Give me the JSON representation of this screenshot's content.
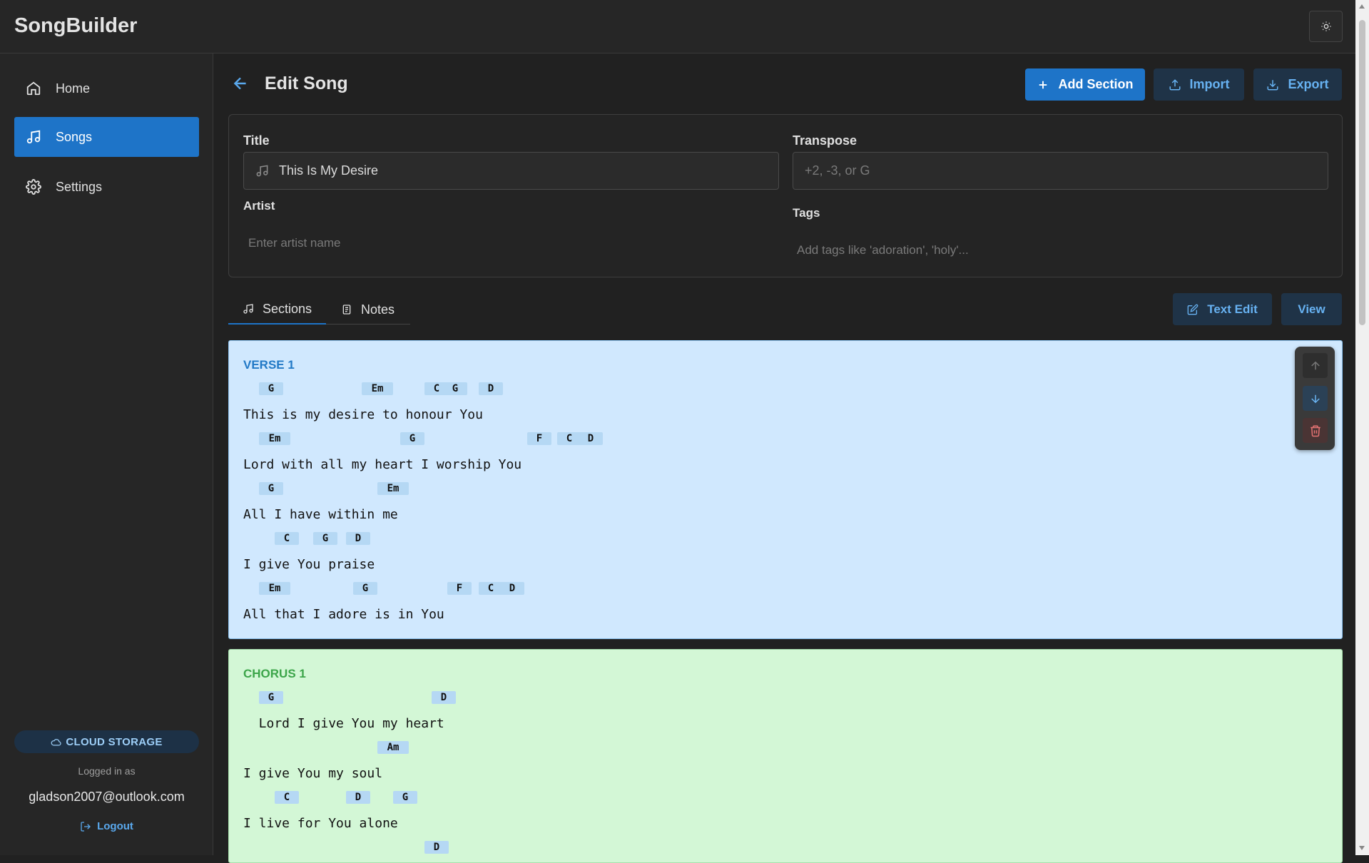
{
  "app": {
    "title": "SongBuilder",
    "theme_icon": "sun-icon"
  },
  "sidebar": {
    "items": [
      {
        "label": "Home",
        "icon": "home-icon"
      },
      {
        "label": "Songs",
        "icon": "music-note-icon",
        "active": true
      },
      {
        "label": "Settings",
        "icon": "gear-icon"
      }
    ],
    "storage_label": "CLOUD STORAGE",
    "logged_in_label": "Logged in as",
    "user_email": "gladson2007@outlook.com",
    "logout_label": "Logout"
  },
  "header": {
    "title": "Edit Song",
    "add_section_label": "Add Section",
    "import_label": "Import",
    "export_label": "Export"
  },
  "form": {
    "title_label": "Title",
    "title_value": "This Is My Desire",
    "transpose_label": "Transpose",
    "transpose_placeholder": "+2, -3, or G",
    "artist_label": "Artist",
    "artist_placeholder": "Enter artist name",
    "tags_label": "Tags",
    "tags_placeholder": "Add tags like 'adoration', 'holy'..."
  },
  "tabs": {
    "sections_label": "Sections",
    "notes_label": "Notes",
    "text_edit_label": "Text Edit",
    "view_label": "View"
  },
  "sections": [
    {
      "title": "VERSE 1",
      "lines": [
        {
          "lyric": "This is my desire to honour You",
          "chords": [
            "G",
            "Em",
            "C",
            "G",
            "D"
          ]
        },
        {
          "lyric": "Lord with all my heart I worship You",
          "chords": [
            "Em",
            "G",
            "F",
            "C",
            "D"
          ]
        },
        {
          "lyric": "All I have within me",
          "chords": [
            "G",
            "Em"
          ]
        },
        {
          "lyric": "I give You praise",
          "chords": [
            "C",
            "G",
            "D"
          ]
        },
        {
          "lyric": "All that I adore is in You",
          "chords": [
            "Em",
            "G",
            "F",
            "C",
            "D"
          ]
        }
      ]
    },
    {
      "title": "CHORUS 1",
      "lines": [
        {
          "lyric": "  Lord I give You my heart",
          "chords": [
            "G",
            "D"
          ]
        },
        {
          "lyric": "I give You my soul",
          "chords": [
            "Am"
          ]
        },
        {
          "lyric": "I live for You alone",
          "chords": [
            "C",
            "D",
            "G"
          ]
        },
        {
          "lyric": "",
          "chords": [
            "D"
          ]
        }
      ]
    }
  ]
}
